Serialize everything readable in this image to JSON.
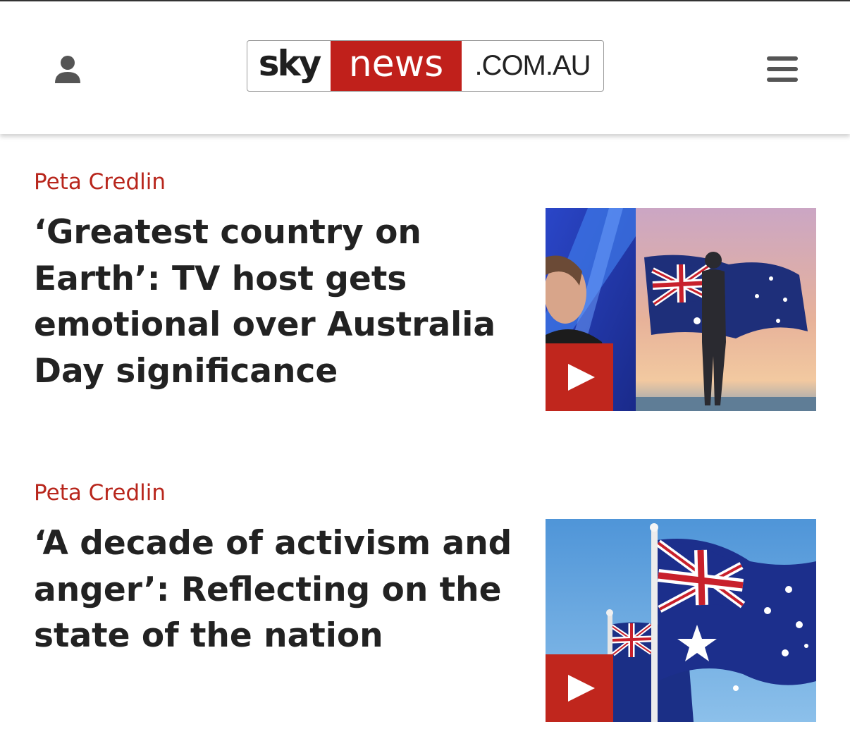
{
  "header": {
    "logo": {
      "part1": "sky",
      "part2": "news",
      "part3": ".COM.AU"
    },
    "user_icon": "user-icon",
    "menu_icon": "hamburger-menu-icon"
  },
  "articles": [
    {
      "category": "Peta Credlin",
      "headline": "‘Greatest country on Earth’: TV host gets emotional over Australia Day significance",
      "media": "video",
      "play_icon": "play-icon"
    },
    {
      "category": "Peta Credlin",
      "headline": "‘A decade of activism and anger’: Reflecting on the state of the nation",
      "media": "video",
      "play_icon": "play-icon"
    }
  ],
  "colors": {
    "brand_red": "#c0201b",
    "category_red": "#b8261c",
    "headline": "#222222"
  }
}
